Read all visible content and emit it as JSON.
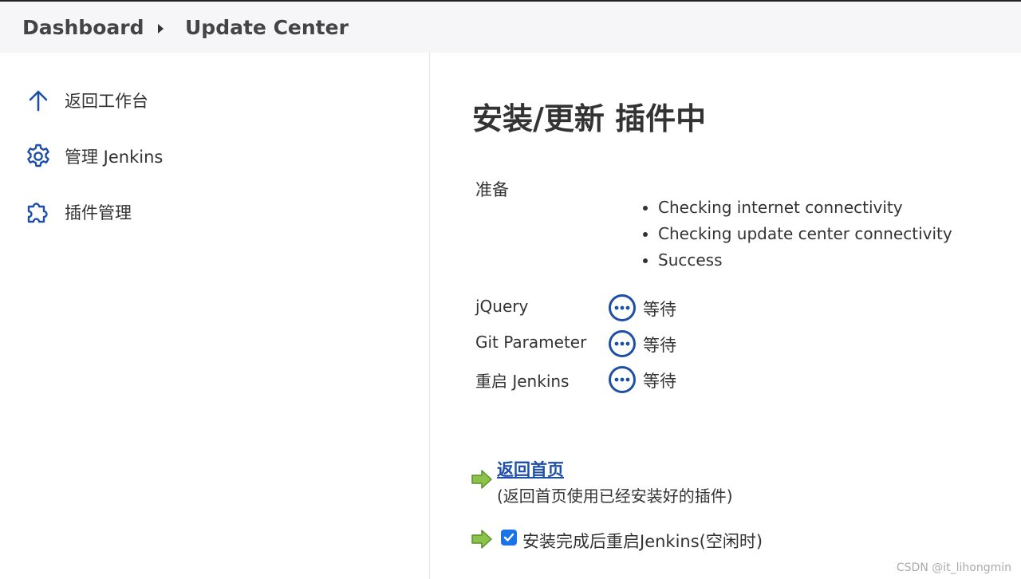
{
  "breadcrumb": {
    "dashboard": "Dashboard",
    "current": "Update Center"
  },
  "sidebar": {
    "items": [
      {
        "label": "返回工作台",
        "icon": "arrow-up-icon"
      },
      {
        "label": "管理 Jenkins",
        "icon": "gear-icon"
      },
      {
        "label": "插件管理",
        "icon": "puzzle-icon"
      }
    ]
  },
  "main": {
    "title": "安装/更新 插件中",
    "preparation": {
      "label": "准备",
      "checks": [
        "Checking internet connectivity",
        "Checking update center connectivity",
        "Success"
      ]
    },
    "plugins": [
      {
        "name": "jQuery",
        "status": "等待"
      },
      {
        "name": "Git Parameter",
        "status": "等待"
      },
      {
        "name": "重启 Jenkins",
        "status": "等待"
      }
    ],
    "back_link": "返回首页",
    "back_note": "(返回首页使用已经安装好的插件)",
    "restart_option": {
      "label": "安装完成后重启Jenkins(空闲时)",
      "checked": true
    }
  },
  "watermark": "CSDN @it_lihongmin",
  "colors": {
    "accent": "#1e4fa8",
    "checkbox": "#1a73e8",
    "arrow": "#7cb342"
  }
}
